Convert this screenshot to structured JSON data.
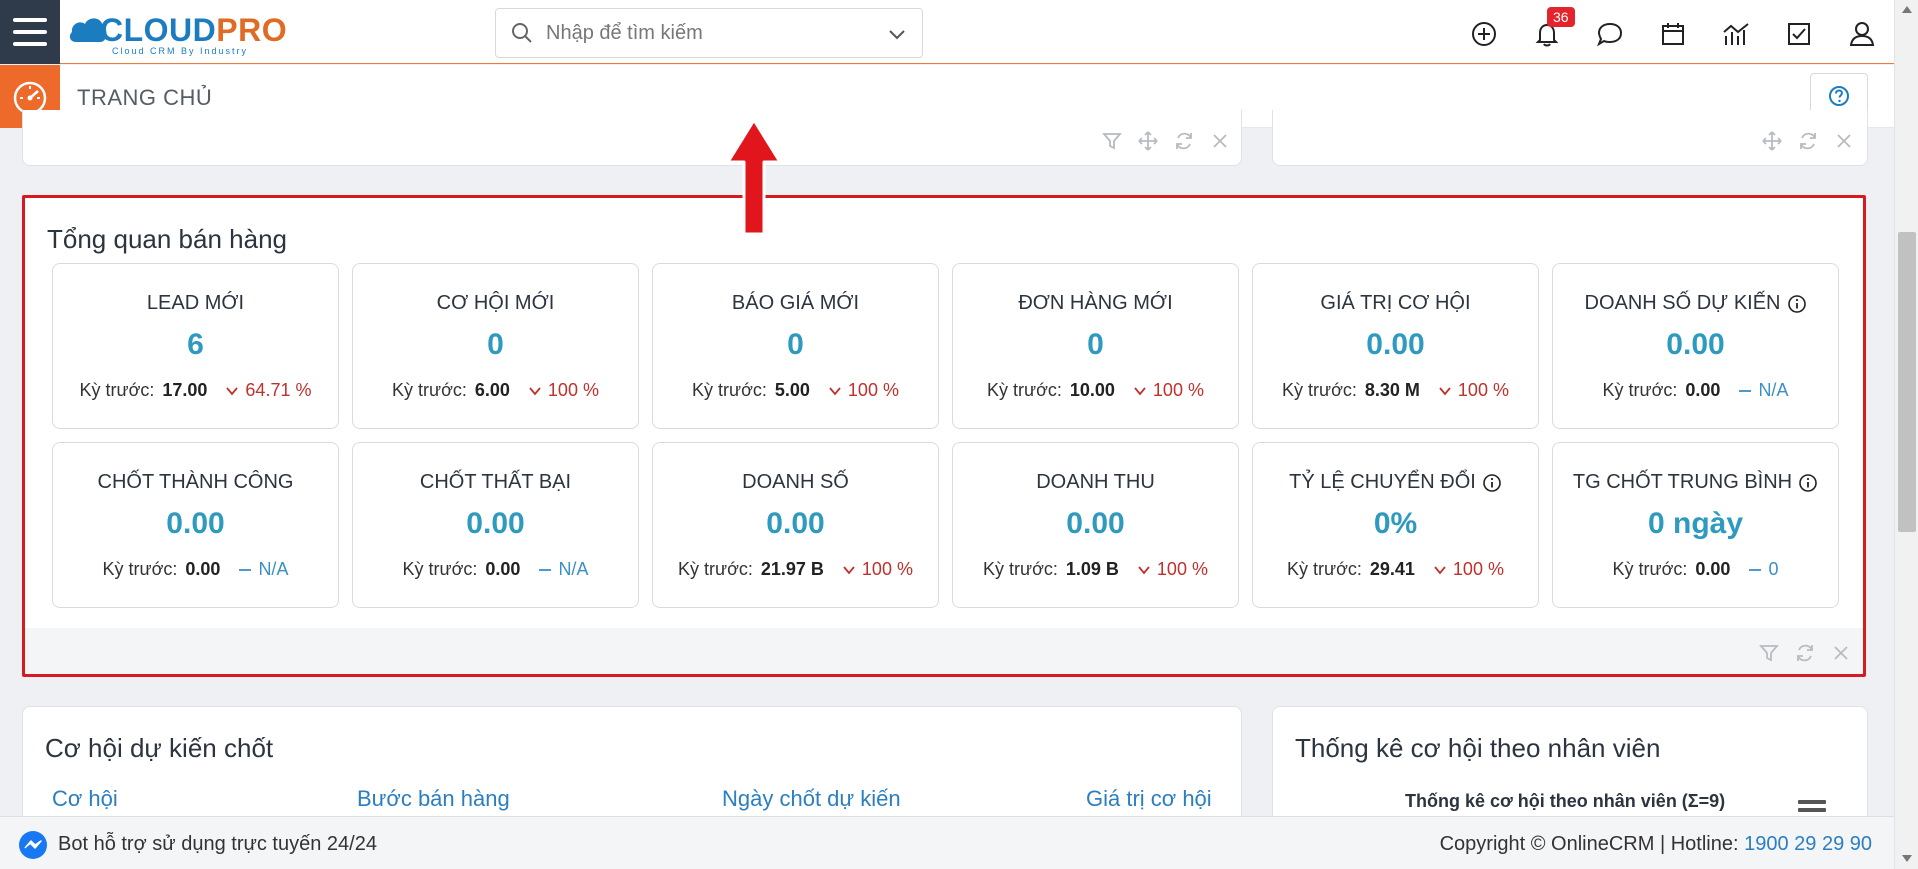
{
  "header": {
    "logo_cloud": "CLOUD",
    "logo_pro": "PRO",
    "logo_tagline": "Cloud CRM By Industry",
    "search_placeholder": "Nhập để tìm kiếm",
    "notification_count": "36"
  },
  "subheader": {
    "title": "TRANG CHỦ"
  },
  "sales_overview": {
    "title": "Tổng quan bán hàng",
    "prev_label": "Kỳ trước:",
    "cards": [
      {
        "label": "LEAD MỚI",
        "value": "6",
        "prev": "17.00",
        "change": "64.71 %",
        "trend": "down",
        "info": false
      },
      {
        "label": "CƠ HỘI MỚI",
        "value": "0",
        "prev": "6.00",
        "change": "100 %",
        "trend": "down",
        "info": false
      },
      {
        "label": "BÁO GIÁ MỚI",
        "value": "0",
        "prev": "5.00",
        "change": "100 %",
        "trend": "down",
        "info": false
      },
      {
        "label": "ĐƠN HÀNG MỚI",
        "value": "0",
        "prev": "10.00",
        "change": "100 %",
        "trend": "down",
        "info": false
      },
      {
        "label": "GIÁ TRỊ CƠ HỘI",
        "value": "0.00",
        "prev": "8.30 M",
        "change": "100 %",
        "trend": "down",
        "info": false
      },
      {
        "label": "DOANH SỐ DỰ KIẾN",
        "value": "0.00",
        "prev": "0.00",
        "change": "N/A",
        "trend": "flat",
        "info": true
      },
      {
        "label": "CHỐT THÀNH CÔNG",
        "value": "0.00",
        "prev": "0.00",
        "change": "N/A",
        "trend": "flat",
        "info": false
      },
      {
        "label": "CHỐT THẤT BẠI",
        "value": "0.00",
        "prev": "0.00",
        "change": "N/A",
        "trend": "flat",
        "info": false
      },
      {
        "label": "DOANH SỐ",
        "value": "0.00",
        "prev": "21.97 B",
        "change": "100 %",
        "trend": "down",
        "info": false
      },
      {
        "label": "DOANH THU",
        "value": "0.00",
        "prev": "1.09 B",
        "change": "100 %",
        "trend": "down",
        "info": false
      },
      {
        "label": "TỶ LỆ CHUYỂN ĐỔI",
        "value": "0%",
        "prev": "29.41",
        "change": "100 %",
        "trend": "down",
        "info": true
      },
      {
        "label": "TG CHỐT TRUNG BÌNH",
        "value": "0 ngày",
        "prev": "0.00",
        "change": "0",
        "trend": "flat",
        "info": true
      }
    ]
  },
  "opportunities": {
    "title": "Cơ hội dự kiến chốt",
    "columns": [
      "Cơ hội",
      "Bước bán hàng",
      "Ngày chốt dự kiến",
      "Giá trị cơ hội"
    ]
  },
  "staff_stats": {
    "title": "Thống kê cơ hội theo nhân viên",
    "chart_title": "Thống kê cơ hội theo nhân viên (Σ=9)"
  },
  "footer": {
    "bot_text": "Bot hỗ trợ sử dụng trực tuyến 24/24",
    "copyright": "Copyright © OnlineCRM | Hotline: ",
    "hotline": "1900 29 29 90"
  },
  "colors": {
    "accent": "#ee6a2b",
    "value_blue": "#2e9ac0",
    "down_red": "#c0302c",
    "highlight_border": "#d71920"
  }
}
